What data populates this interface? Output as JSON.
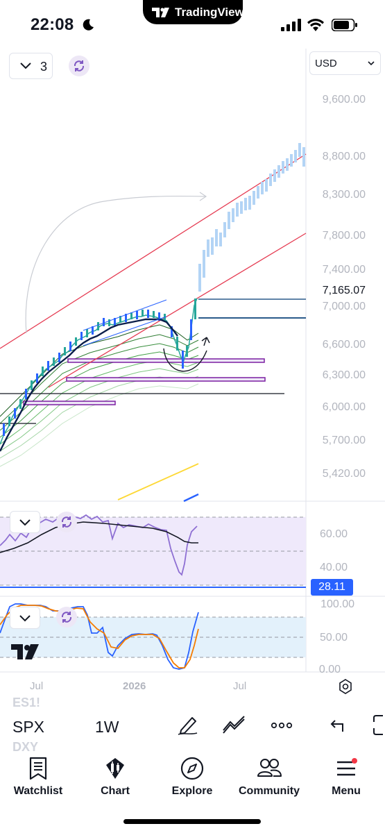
{
  "status_bar": {
    "time": "22:08",
    "app_pill": "TradingView"
  },
  "chart": {
    "layout_count": "3",
    "currency": "USD",
    "price_axis": [
      "9,600.00",
      "8,800.00",
      "8,300.00",
      "7,800.00",
      "7,400.00",
      "7,000.00",
      "6,600.00",
      "6,300.00",
      "6,000.00",
      "5,700.00",
      "5,420.00"
    ],
    "current_price": "7,165.07",
    "rsi_axis": [
      "60.00",
      "40.00"
    ],
    "rsi_value": "28.11",
    "stoch_axis": [
      "100.00",
      "50.00",
      "0.00"
    ],
    "time_axis": [
      "Jul",
      "2026",
      "Jul"
    ],
    "colors": {
      "channel": "#e53950",
      "rsi_line": "#8e6fd3",
      "rsi_band": "#efe9fb",
      "stoch_band": "#e3f1fb",
      "badge": "#2962ff"
    }
  },
  "toolbar": {
    "ghost_symbols": [
      "ES1!",
      "DXY"
    ],
    "symbol": "SPX",
    "interval": "1W",
    "icons": [
      "pen-icon",
      "indicators-icon",
      "more-icon",
      "undo-icon",
      "fullscreen-icon"
    ]
  },
  "nav": {
    "watchlist": "Watchlist",
    "chart": "Chart",
    "explore": "Explore",
    "community": "Community",
    "menu": "Menu"
  }
}
